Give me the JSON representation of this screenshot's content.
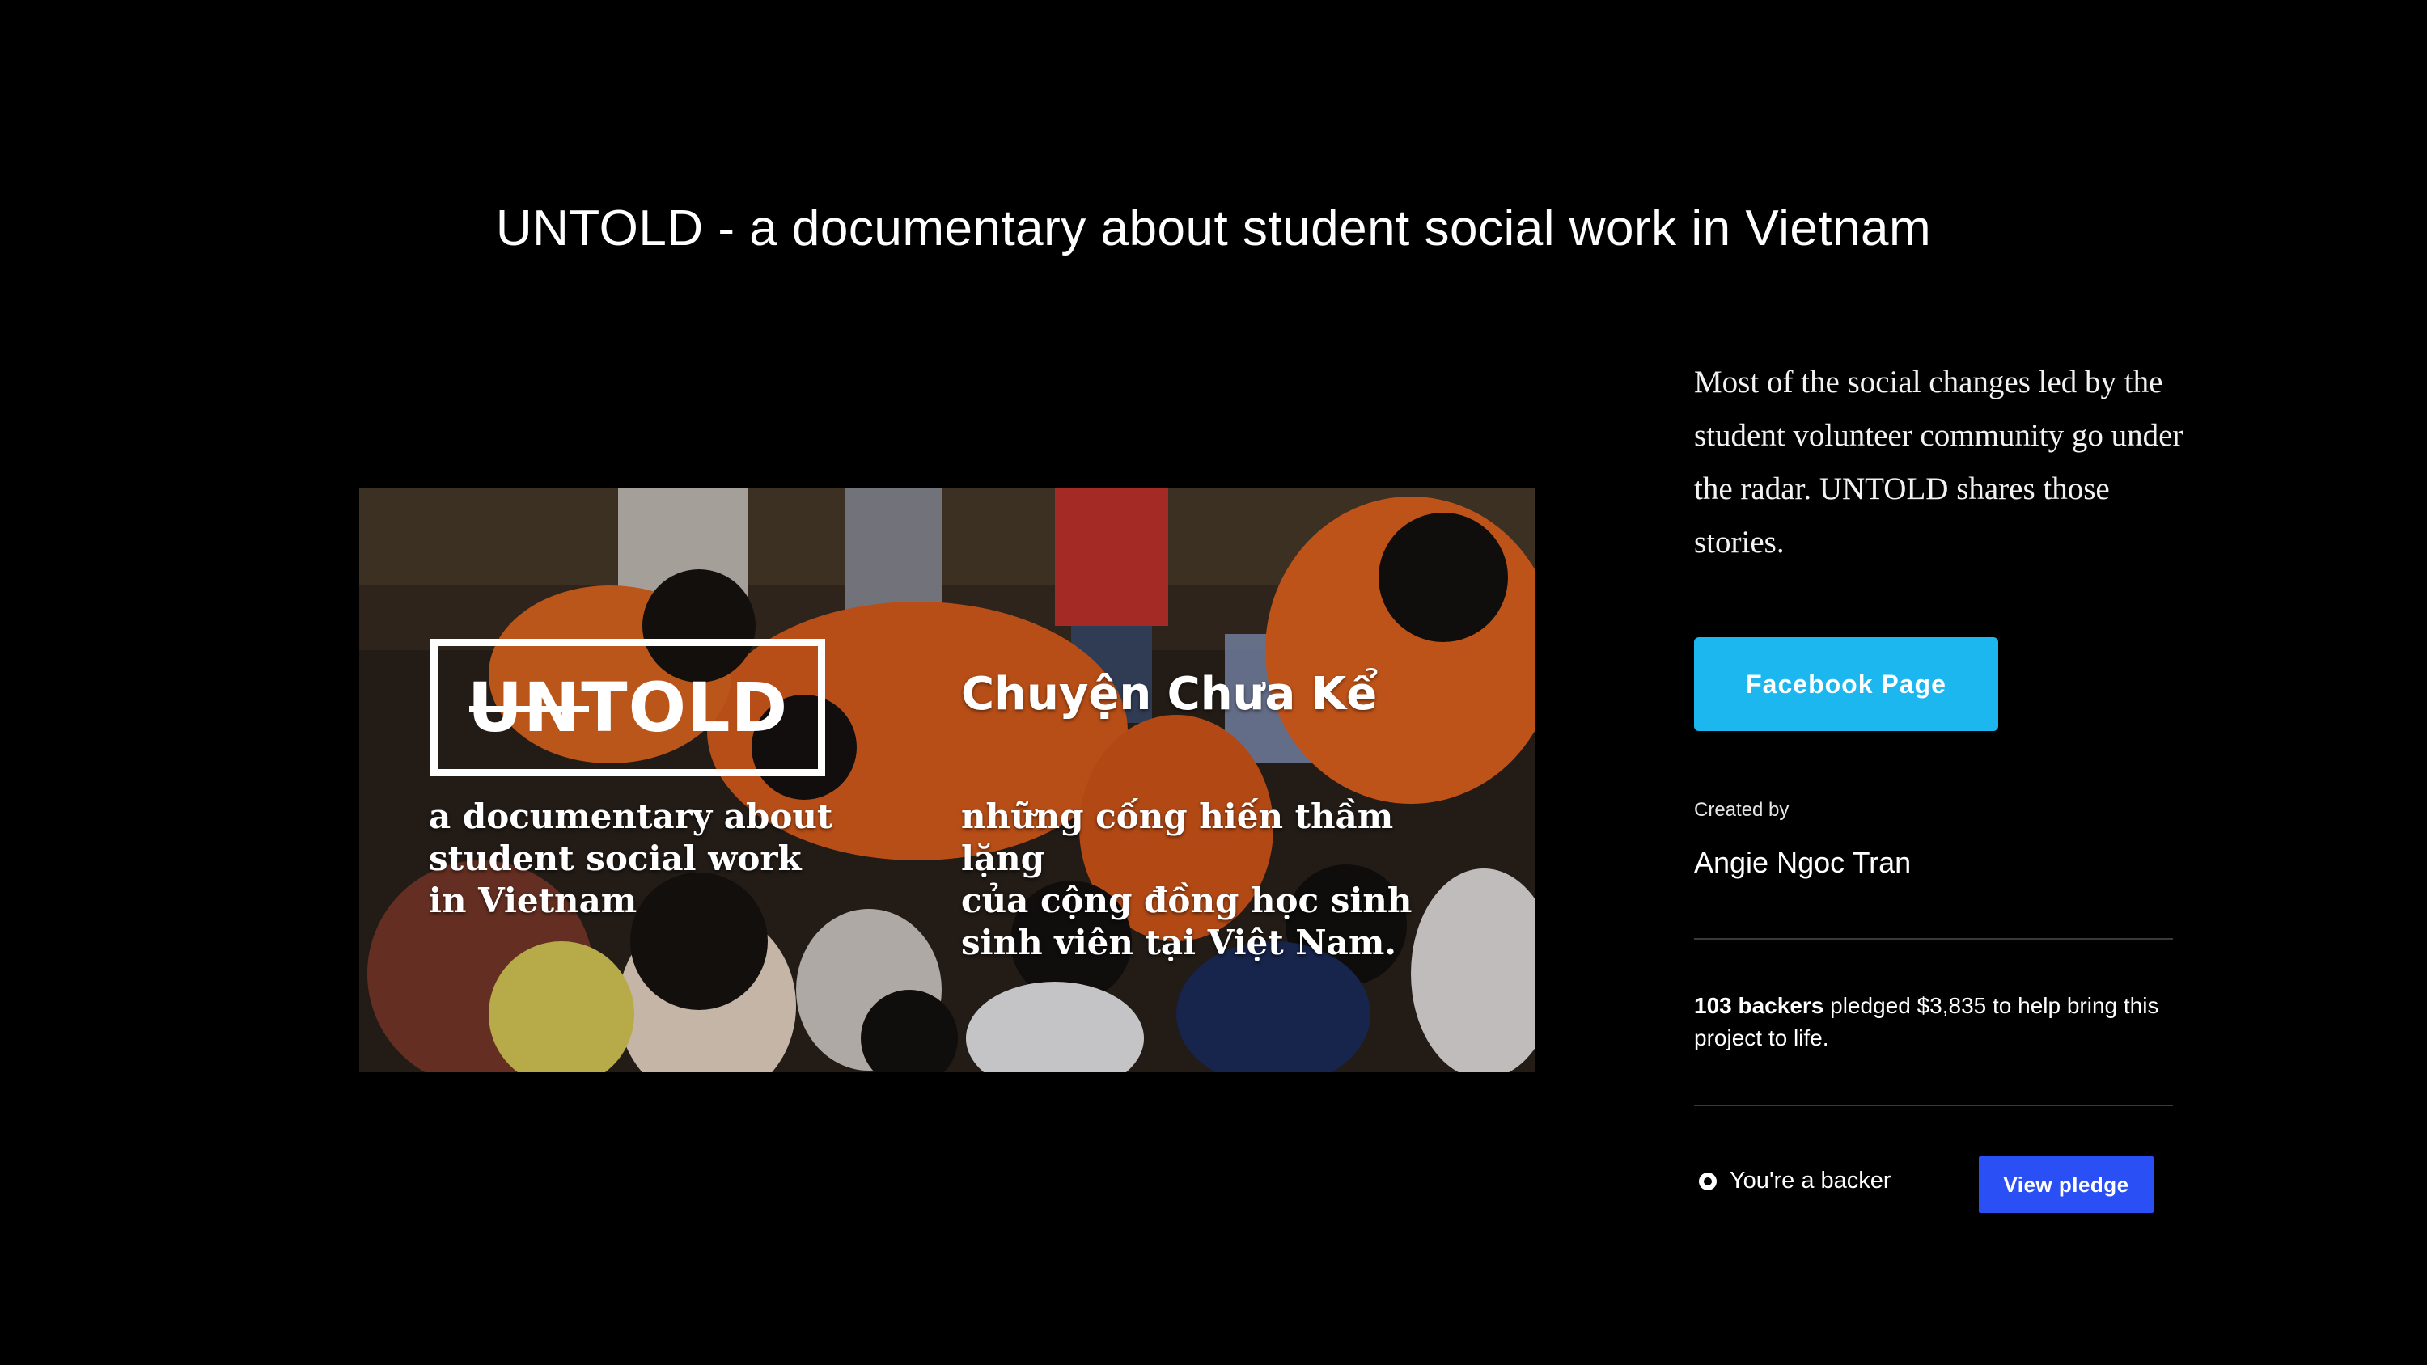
{
  "project": {
    "title": "UNTOLD - a documentary about student social work in Vietnam"
  },
  "hero": {
    "logo": "UNTOLD",
    "subtitle_en": "a documentary about\nstudent social work\nin Vietnam",
    "title_vi": "Chuyện Chưa Kể",
    "subtitle_vi": "những cống hiến thầm lặng\ncủa cộng đồng học sinh\nsinh viên tại Việt Nam."
  },
  "sidebar": {
    "blurb": "Most of the social changes led by the student volunteer community go under the radar. UNTOLD shares those stories.",
    "facebook_label": "Facebook Page",
    "created_by_label": "Created by",
    "creator_name": "Angie Ngoc Tran",
    "backers_count": "103 backers",
    "backers_rest": " pledged $3,835 to help bring this project to life.",
    "backer_status": "You're a backer",
    "view_pledge_label": "View pledge"
  },
  "colors": {
    "background": "#000000",
    "facebook_button": "#1bb7ee",
    "view_pledge_button": "#2a4ff5",
    "hero_shirts": "#e8661f"
  },
  "icons": {
    "backer_status": "kickstarter-badge-icon"
  }
}
